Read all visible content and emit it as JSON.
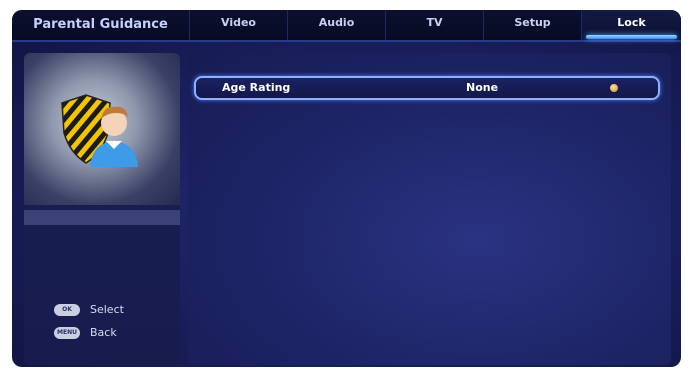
{
  "header": {
    "title": "Parental Guidance",
    "tabs": [
      {
        "label": "Video",
        "active": false
      },
      {
        "label": "Audio",
        "active": false
      },
      {
        "label": "TV",
        "active": false
      },
      {
        "label": "Setup",
        "active": false
      },
      {
        "label": "Lock",
        "active": true
      }
    ]
  },
  "settings": {
    "rows": [
      {
        "label": "Age Rating",
        "value": "None"
      }
    ]
  },
  "hints": {
    "select_label": "Select",
    "back_label": "Back",
    "ok_key": "OK",
    "menu_key": "MENU"
  },
  "colors": {
    "accent": "#5aaaff",
    "background": "#1b2160",
    "selection_border": "#8fb0ff"
  },
  "icons": [
    "lock-guard-shield-icon",
    "user-avatar-icon",
    "ok-button-icon",
    "menu-button-icon",
    "option-dot-icon"
  ]
}
